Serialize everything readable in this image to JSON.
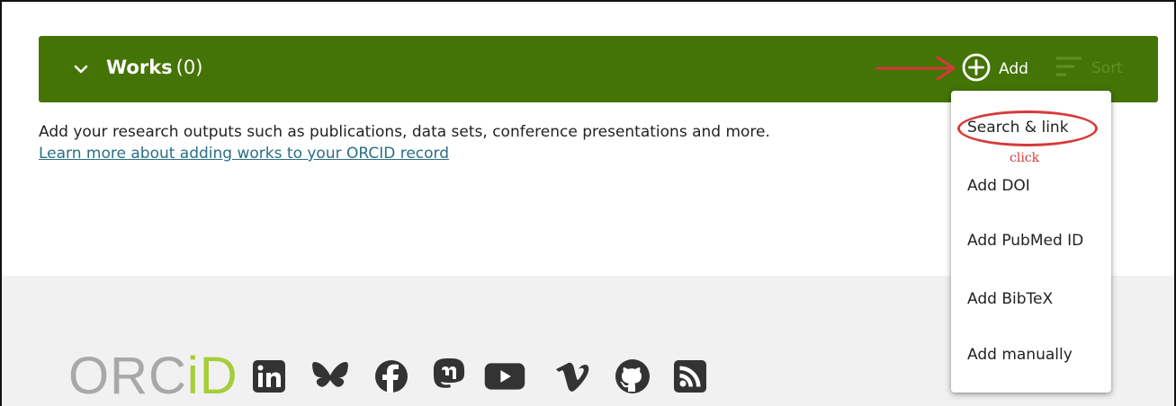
{
  "works": {
    "title": "Works",
    "count": "(0)",
    "add_label": "Add",
    "sort_label": "Sort"
  },
  "description": "Add your research outputs such as publications, data sets, conference presentations and more.",
  "learn_more": "Learn more about adding works to your ORCID record",
  "menu": {
    "items": [
      "Search & link",
      "Add DOI",
      "Add PubMed ID",
      "Add BibTeX",
      "Add manually"
    ]
  },
  "annotation": {
    "click_note": "click",
    "color": "#d63a3a"
  },
  "footer": {
    "logo_text_left": "ORC",
    "logo_text_right": "iD",
    "social_icons": [
      "linkedin-icon",
      "bluesky-icon",
      "facebook-icon",
      "mastodon-icon",
      "youtube-icon",
      "vimeo-icon",
      "github-icon",
      "rss-icon"
    ]
  },
  "colors": {
    "works_bar": "#447405",
    "link": "#2a6f86",
    "logo_green": "#a6ce39",
    "footer_bg": "#f1f1f1"
  }
}
